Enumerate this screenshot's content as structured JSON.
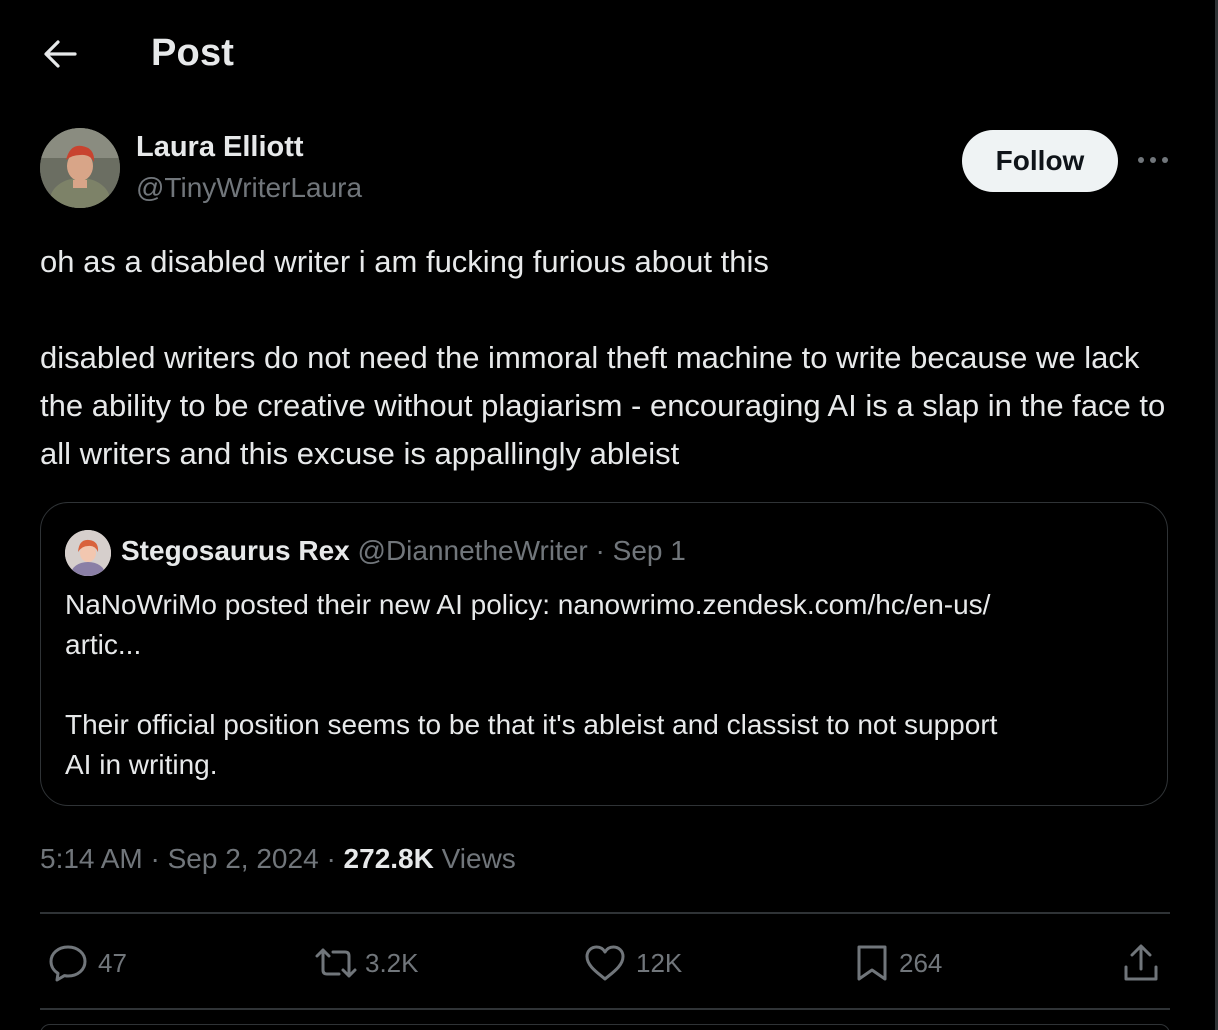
{
  "header": {
    "title": "Post"
  },
  "post": {
    "author_name": "Laura Elliott",
    "author_handle": "@TinyWriterLaura",
    "follow_label": "Follow",
    "text": "oh as a disabled writer i am fucking furious about this\n\ndisabled writers do not need the immoral theft machine to write because we lack the ability to be creative without plagiarism - encouraging AI is a slap in the face to all writers and this excuse is appallingly ableist"
  },
  "quote": {
    "author_name": "Stegosaurus Rex",
    "author_handle": "@DiannetheWriter",
    "separator": "·",
    "date": "Sep 1",
    "text": "NaNoWriMo posted their new AI policy: nanowrimo.zendesk.com/hc/en-us/\nartic...\n\nTheir official position seems to be that it's ableist and classist to not support\nAI in writing."
  },
  "meta": {
    "time": "5:14 AM",
    "separator": "·",
    "date": "Sep 2, 2024",
    "views_count": "272.8K",
    "views_label": "Views"
  },
  "actions": {
    "replies": "47",
    "reposts": "3.2K",
    "likes": "12K",
    "bookmarks": "264"
  },
  "icons": {
    "back": "arrow-left-icon",
    "more": "more-horizontal-icon",
    "reply": "reply-icon",
    "repost": "repost-icon",
    "like": "heart-icon",
    "bookmark": "bookmark-icon",
    "share": "share-icon"
  },
  "colors": {
    "background": "#000000",
    "text_primary": "#e7e9ea",
    "text_secondary": "#71767b",
    "border": "#2f3336",
    "follow_bg": "#eff3f4"
  }
}
